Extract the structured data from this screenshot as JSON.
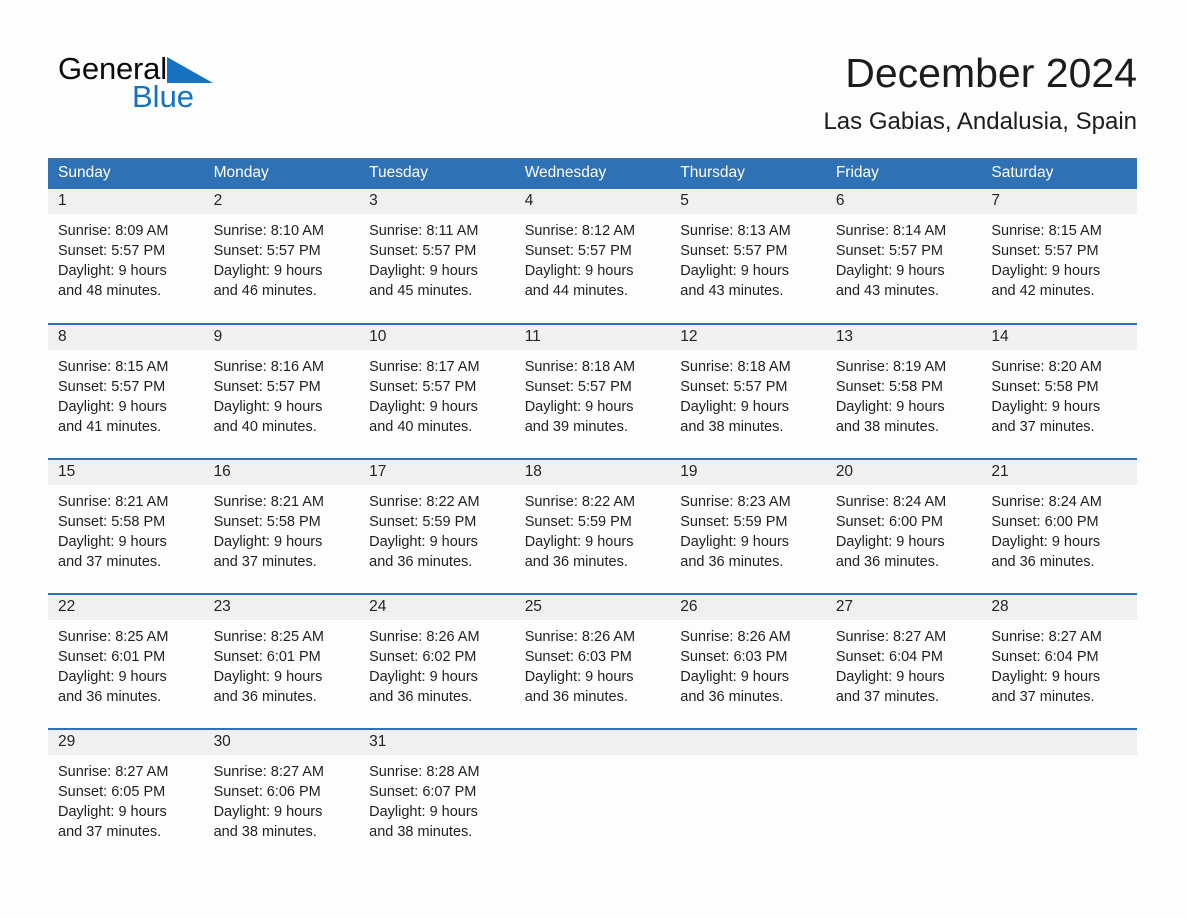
{
  "brand": {
    "word1": "General",
    "word2": "Blue",
    "triangle_icon": "brand-triangle-icon",
    "accent_color": "#1572c0"
  },
  "header": {
    "title": "December 2024",
    "subtitle": "Las Gabias, Andalusia, Spain"
  },
  "theme": {
    "header_blue": "#2e71b4",
    "daynum_band": "#f0f0f0",
    "page_background": "#fdfdfd",
    "text": "#1f1f1f"
  },
  "weekdays": [
    "Sunday",
    "Monday",
    "Tuesday",
    "Wednesday",
    "Thursday",
    "Friday",
    "Saturday"
  ],
  "weeks": [
    [
      {
        "day": "1",
        "sunrise": "Sunrise: 8:09 AM",
        "sunset": "Sunset: 5:57 PM",
        "daylight1": "Daylight: 9 hours",
        "daylight2": "and 48 minutes."
      },
      {
        "day": "2",
        "sunrise": "Sunrise: 8:10 AM",
        "sunset": "Sunset: 5:57 PM",
        "daylight1": "Daylight: 9 hours",
        "daylight2": "and 46 minutes."
      },
      {
        "day": "3",
        "sunrise": "Sunrise: 8:11 AM",
        "sunset": "Sunset: 5:57 PM",
        "daylight1": "Daylight: 9 hours",
        "daylight2": "and 45 minutes."
      },
      {
        "day": "4",
        "sunrise": "Sunrise: 8:12 AM",
        "sunset": "Sunset: 5:57 PM",
        "daylight1": "Daylight: 9 hours",
        "daylight2": "and 44 minutes."
      },
      {
        "day": "5",
        "sunrise": "Sunrise: 8:13 AM",
        "sunset": "Sunset: 5:57 PM",
        "daylight1": "Daylight: 9 hours",
        "daylight2": "and 43 minutes."
      },
      {
        "day": "6",
        "sunrise": "Sunrise: 8:14 AM",
        "sunset": "Sunset: 5:57 PM",
        "daylight1": "Daylight: 9 hours",
        "daylight2": "and 43 minutes."
      },
      {
        "day": "7",
        "sunrise": "Sunrise: 8:15 AM",
        "sunset": "Sunset: 5:57 PM",
        "daylight1": "Daylight: 9 hours",
        "daylight2": "and 42 minutes."
      }
    ],
    [
      {
        "day": "8",
        "sunrise": "Sunrise: 8:15 AM",
        "sunset": "Sunset: 5:57 PM",
        "daylight1": "Daylight: 9 hours",
        "daylight2": "and 41 minutes."
      },
      {
        "day": "9",
        "sunrise": "Sunrise: 8:16 AM",
        "sunset": "Sunset: 5:57 PM",
        "daylight1": "Daylight: 9 hours",
        "daylight2": "and 40 minutes."
      },
      {
        "day": "10",
        "sunrise": "Sunrise: 8:17 AM",
        "sunset": "Sunset: 5:57 PM",
        "daylight1": "Daylight: 9 hours",
        "daylight2": "and 40 minutes."
      },
      {
        "day": "11",
        "sunrise": "Sunrise: 8:18 AM",
        "sunset": "Sunset: 5:57 PM",
        "daylight1": "Daylight: 9 hours",
        "daylight2": "and 39 minutes."
      },
      {
        "day": "12",
        "sunrise": "Sunrise: 8:18 AM",
        "sunset": "Sunset: 5:57 PM",
        "daylight1": "Daylight: 9 hours",
        "daylight2": "and 38 minutes."
      },
      {
        "day": "13",
        "sunrise": "Sunrise: 8:19 AM",
        "sunset": "Sunset: 5:58 PM",
        "daylight1": "Daylight: 9 hours",
        "daylight2": "and 38 minutes."
      },
      {
        "day": "14",
        "sunrise": "Sunrise: 8:20 AM",
        "sunset": "Sunset: 5:58 PM",
        "daylight1": "Daylight: 9 hours",
        "daylight2": "and 37 minutes."
      }
    ],
    [
      {
        "day": "15",
        "sunrise": "Sunrise: 8:21 AM",
        "sunset": "Sunset: 5:58 PM",
        "daylight1": "Daylight: 9 hours",
        "daylight2": "and 37 minutes."
      },
      {
        "day": "16",
        "sunrise": "Sunrise: 8:21 AM",
        "sunset": "Sunset: 5:58 PM",
        "daylight1": "Daylight: 9 hours",
        "daylight2": "and 37 minutes."
      },
      {
        "day": "17",
        "sunrise": "Sunrise: 8:22 AM",
        "sunset": "Sunset: 5:59 PM",
        "daylight1": "Daylight: 9 hours",
        "daylight2": "and 36 minutes."
      },
      {
        "day": "18",
        "sunrise": "Sunrise: 8:22 AM",
        "sunset": "Sunset: 5:59 PM",
        "daylight1": "Daylight: 9 hours",
        "daylight2": "and 36 minutes."
      },
      {
        "day": "19",
        "sunrise": "Sunrise: 8:23 AM",
        "sunset": "Sunset: 5:59 PM",
        "daylight1": "Daylight: 9 hours",
        "daylight2": "and 36 minutes."
      },
      {
        "day": "20",
        "sunrise": "Sunrise: 8:24 AM",
        "sunset": "Sunset: 6:00 PM",
        "daylight1": "Daylight: 9 hours",
        "daylight2": "and 36 minutes."
      },
      {
        "day": "21",
        "sunrise": "Sunrise: 8:24 AM",
        "sunset": "Sunset: 6:00 PM",
        "daylight1": "Daylight: 9 hours",
        "daylight2": "and 36 minutes."
      }
    ],
    [
      {
        "day": "22",
        "sunrise": "Sunrise: 8:25 AM",
        "sunset": "Sunset: 6:01 PM",
        "daylight1": "Daylight: 9 hours",
        "daylight2": "and 36 minutes."
      },
      {
        "day": "23",
        "sunrise": "Sunrise: 8:25 AM",
        "sunset": "Sunset: 6:01 PM",
        "daylight1": "Daylight: 9 hours",
        "daylight2": "and 36 minutes."
      },
      {
        "day": "24",
        "sunrise": "Sunrise: 8:26 AM",
        "sunset": "Sunset: 6:02 PM",
        "daylight1": "Daylight: 9 hours",
        "daylight2": "and 36 minutes."
      },
      {
        "day": "25",
        "sunrise": "Sunrise: 8:26 AM",
        "sunset": "Sunset: 6:03 PM",
        "daylight1": "Daylight: 9 hours",
        "daylight2": "and 36 minutes."
      },
      {
        "day": "26",
        "sunrise": "Sunrise: 8:26 AM",
        "sunset": "Sunset: 6:03 PM",
        "daylight1": "Daylight: 9 hours",
        "daylight2": "and 36 minutes."
      },
      {
        "day": "27",
        "sunrise": "Sunrise: 8:27 AM",
        "sunset": "Sunset: 6:04 PM",
        "daylight1": "Daylight: 9 hours",
        "daylight2": "and 37 minutes."
      },
      {
        "day": "28",
        "sunrise": "Sunrise: 8:27 AM",
        "sunset": "Sunset: 6:04 PM",
        "daylight1": "Daylight: 9 hours",
        "daylight2": "and 37 minutes."
      }
    ],
    [
      {
        "day": "29",
        "sunrise": "Sunrise: 8:27 AM",
        "sunset": "Sunset: 6:05 PM",
        "daylight1": "Daylight: 9 hours",
        "daylight2": "and 37 minutes."
      },
      {
        "day": "30",
        "sunrise": "Sunrise: 8:27 AM",
        "sunset": "Sunset: 6:06 PM",
        "daylight1": "Daylight: 9 hours",
        "daylight2": "and 38 minutes."
      },
      {
        "day": "31",
        "sunrise": "Sunrise: 8:28 AM",
        "sunset": "Sunset: 6:07 PM",
        "daylight1": "Daylight: 9 hours",
        "daylight2": "and 38 minutes."
      },
      {
        "day": "",
        "sunrise": "",
        "sunset": "",
        "daylight1": "",
        "daylight2": ""
      },
      {
        "day": "",
        "sunrise": "",
        "sunset": "",
        "daylight1": "",
        "daylight2": ""
      },
      {
        "day": "",
        "sunrise": "",
        "sunset": "",
        "daylight1": "",
        "daylight2": ""
      },
      {
        "day": "",
        "sunrise": "",
        "sunset": "",
        "daylight1": "",
        "daylight2": ""
      }
    ]
  ]
}
